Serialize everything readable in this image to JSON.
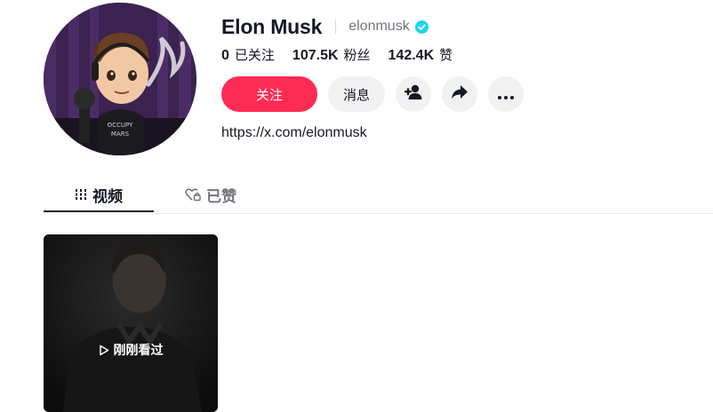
{
  "profile": {
    "display_name": "Elon Musk",
    "username": "elonmusk",
    "verified": true,
    "bio_link": "https://x.com/elonmusk"
  },
  "stats": [
    {
      "value": "0",
      "label": "已关注"
    },
    {
      "value": "107.5K",
      "label": "粉丝"
    },
    {
      "value": "142.4K",
      "label": "赞"
    }
  ],
  "actions": {
    "follow_label": "关注",
    "message_label": "消息",
    "add_friend_icon": "add-user-icon",
    "share_icon": "share-icon",
    "more_icon": "more-icon"
  },
  "tabs": [
    {
      "label": "视频",
      "icon": "grid-icon",
      "active": true
    },
    {
      "label": "已赞",
      "icon": "heart-lock-icon",
      "active": false
    }
  ],
  "videos": [
    {
      "overlay_label": "刚刚看过"
    }
  ],
  "colors": {
    "accent": "#fe2c55",
    "verified": "#20d5ec",
    "text_primary": "#161823",
    "text_secondary": "#73747b"
  }
}
